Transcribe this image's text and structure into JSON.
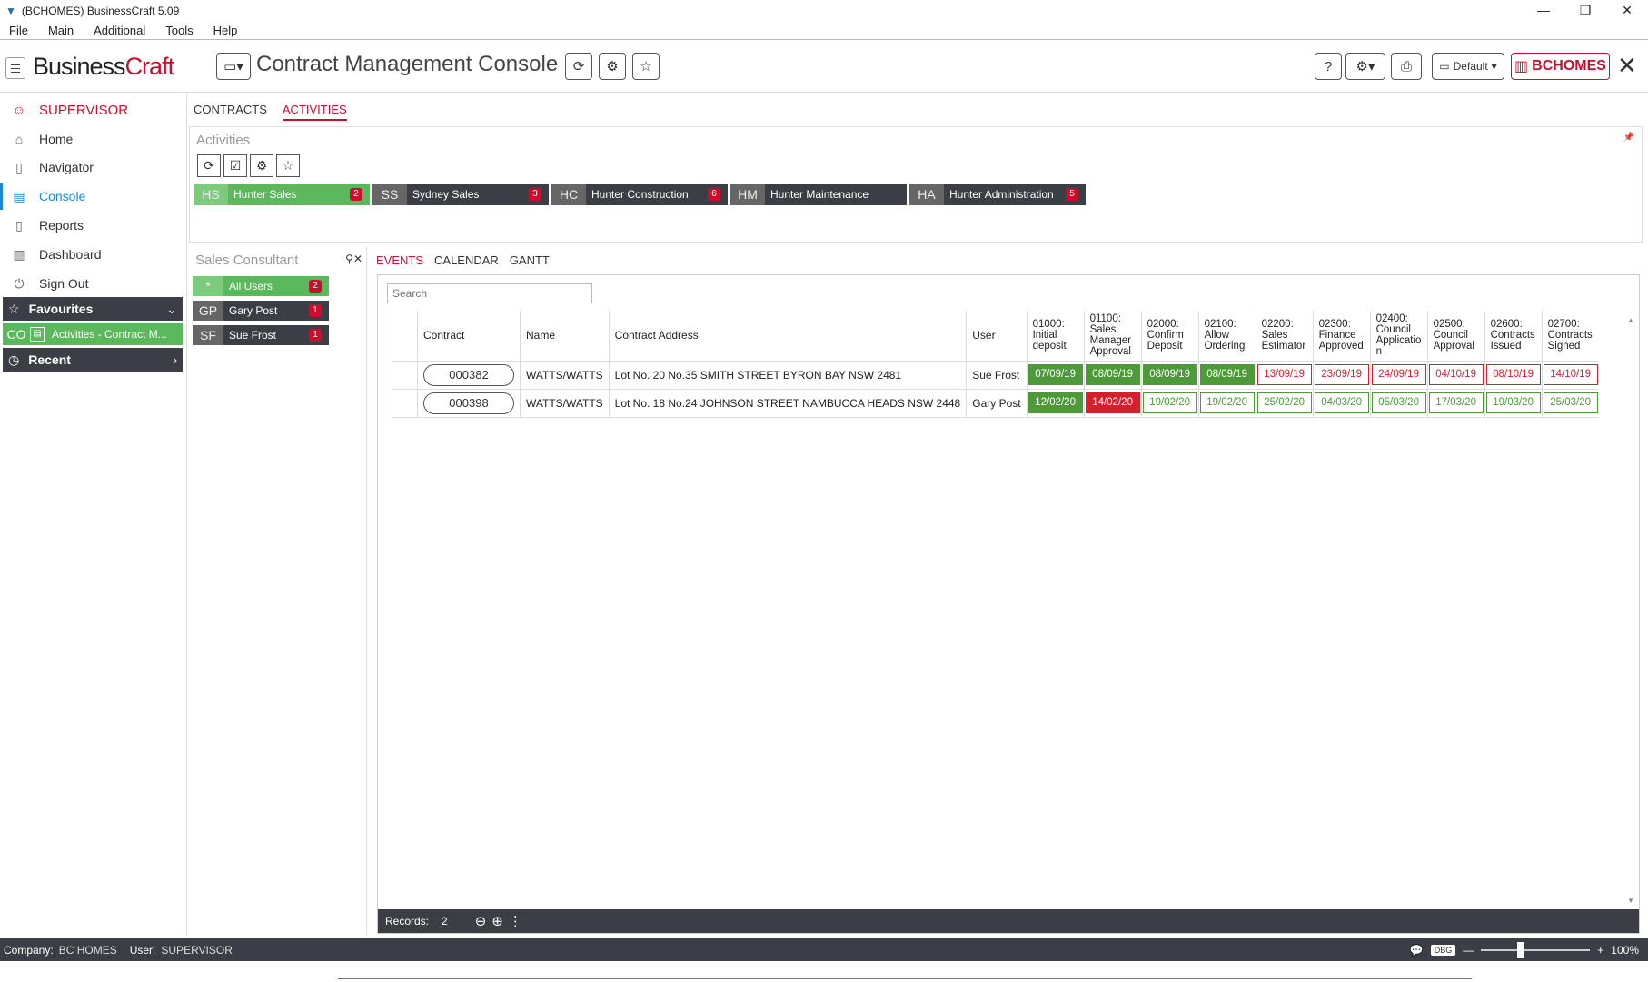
{
  "window": {
    "title": "(BCHOMES) BusinessCraft  5.09",
    "min": "—",
    "restore": "❐",
    "close": "✕"
  },
  "menu": [
    "File",
    "Main",
    "Additional",
    "Tools",
    "Help"
  ],
  "header": {
    "brand_a": "Business",
    "brand_b": "Craft",
    "console_title": "Contract Management Console",
    "default_label": "Default",
    "company_btn": "BCHOMES"
  },
  "sidebar": {
    "user": "SUPERVISOR",
    "items": [
      {
        "label": "Home",
        "icon": "home-icon"
      },
      {
        "label": "Navigator",
        "icon": "map-icon"
      },
      {
        "label": "Console",
        "icon": "console-icon"
      },
      {
        "label": "Reports",
        "icon": "document-icon"
      },
      {
        "label": "Dashboard",
        "icon": "chart-icon"
      },
      {
        "label": "Sign Out",
        "icon": "power-icon"
      }
    ],
    "favourites": "Favourites",
    "fav_item_code": "CO",
    "fav_item_label": "Activities - Contract M...",
    "recent": "Recent"
  },
  "tabs": {
    "contracts": "CONTRACTS",
    "activities": "ACTIVITIES"
  },
  "activities": {
    "title": "Activities",
    "groups": [
      {
        "code": "HS",
        "name": "Hunter Sales",
        "count": "2"
      },
      {
        "code": "SS",
        "name": "Sydney Sales",
        "count": "3"
      },
      {
        "code": "HC",
        "name": "Hunter Construction",
        "count": "6"
      },
      {
        "code": "HM",
        "name": "Hunter Maintenance",
        "count": ""
      },
      {
        "code": "HA",
        "name": "Hunter Administration",
        "count": "5"
      }
    ]
  },
  "consultant": {
    "title": "Sales Consultant",
    "users": [
      {
        "code": "*",
        "name": "All Users",
        "count": "2"
      },
      {
        "code": "GP",
        "name": "Gary Post",
        "count": "1"
      },
      {
        "code": "SF",
        "name": "Sue Frost",
        "count": "1"
      }
    ]
  },
  "event_tabs": {
    "events": "EVENTS",
    "calendar": "CALENDAR",
    "gantt": "GANTT"
  },
  "grid": {
    "search_placeholder": "Search",
    "columns": {
      "contract": "Contract",
      "name": "Name",
      "address": "Contract Address",
      "user": "User",
      "a1": "01000: Initial deposit",
      "a2": "01100: Sales Manager Approval",
      "a3": "02000: Confirm Deposit",
      "a4": "02100: Allow Ordering",
      "a5": "02200: Sales Estimator",
      "a6": "02300: Finance Approved",
      "a7": "02400: Council Applicatio n",
      "a8": "02500: Council Approval",
      "a9": "02600: Contracts Issued",
      "a10": "02700: Contracts Signed"
    },
    "rows": [
      {
        "contract": "000382",
        "name": "WATTS/WATTS",
        "address": "Lot No. 20 No.35 SMITH STREET BYRON BAY NSW 2481",
        "user": "Sue Frost",
        "dates": [
          "07/09/19",
          "08/09/19",
          "08/09/19",
          "08/09/19",
          "13/09/19",
          "23/09/19",
          "24/09/19",
          "04/10/19",
          "08/10/19",
          "14/10/19"
        ],
        "status": [
          "done",
          "done",
          "done",
          "done",
          "due",
          "due",
          "due",
          "due",
          "due",
          "due"
        ]
      },
      {
        "contract": "000398",
        "name": "WATTS/WATTS",
        "address": "Lot No. 18 No.24 JOHNSON STREET NAMBUCCA HEADS NSW 2448",
        "user": "Gary Post",
        "dates": [
          "12/02/20",
          "14/02/20",
          "19/02/20",
          "19/02/20",
          "25/02/20",
          "04/03/20",
          "05/03/20",
          "17/03/20",
          "19/03/20",
          "25/03/20"
        ],
        "status": [
          "done",
          "late",
          "ok",
          "ok",
          "ok",
          "ok",
          "ok",
          "ok",
          "ok",
          "ok"
        ]
      }
    ],
    "records_label": "Records:",
    "records_count": "2"
  },
  "status": {
    "company_label": "Company:",
    "company": "BC HOMES",
    "user_label": "User:",
    "user": "SUPERVISOR",
    "dbg": "DBG",
    "zoom": "100%"
  },
  "colors": {
    "brand_red": "#c8102e",
    "accent_blue": "#1a88d8",
    "done_green": "#4e9a3a",
    "late_red": "#d4202c",
    "dark_bar": "#3b3f45"
  }
}
